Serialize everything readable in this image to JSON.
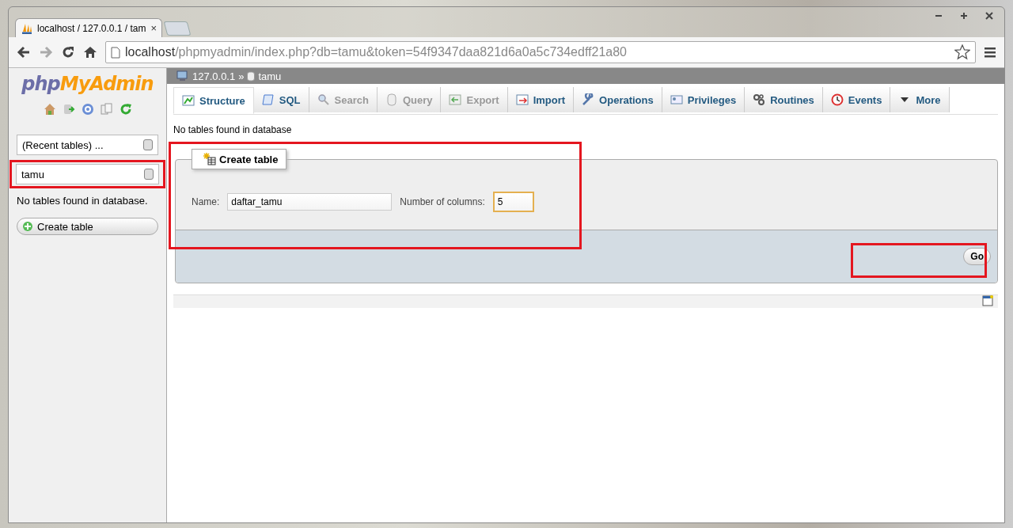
{
  "browser": {
    "tabs": [
      {
        "title": "localhost / 127.0.0.1 / tam",
        "selected": true,
        "kind": "page"
      },
      {
        "selected": false,
        "kind": "new"
      }
    ],
    "close_tab": "×",
    "url_host": "localhost",
    "url_path": "/phpmyadmin/index.php?db=tamu&token=54f9347daa821d6a0a5c734edff21a80"
  },
  "sidebar": {
    "logo_php": "php",
    "logo_rest": "MyAdmin",
    "recent_tables": "(Recent tables) ...",
    "database": "tamu",
    "message": "No tables found in database.",
    "create_button": "Create table"
  },
  "breadcrumb": {
    "server": "127.0.0.1",
    "separator": "»",
    "database": "tamu"
  },
  "tabs": [
    {
      "label": "Structure",
      "selected": true,
      "disabled": false
    },
    {
      "label": "SQL",
      "selected": false,
      "disabled": false
    },
    {
      "label": "Search",
      "selected": false,
      "disabled": true
    },
    {
      "label": "Query",
      "selected": false,
      "disabled": true
    },
    {
      "label": "Export",
      "selected": false,
      "disabled": true
    },
    {
      "label": "Import",
      "selected": false,
      "disabled": false
    },
    {
      "label": "Operations",
      "selected": false,
      "disabled": false
    },
    {
      "label": "Privileges",
      "selected": false,
      "disabled": false
    },
    {
      "label": "Routines",
      "selected": false,
      "disabled": false
    },
    {
      "label": "Events",
      "selected": false,
      "disabled": false
    },
    {
      "label": "More",
      "selected": false,
      "disabled": false
    }
  ],
  "message": "No tables found in database",
  "create_form": {
    "legend": "Create table",
    "name_label": "Name:",
    "name_value": "daftar_tamu",
    "columns_label": "Number of columns:",
    "columns_value": "5",
    "go_button": "Go"
  }
}
